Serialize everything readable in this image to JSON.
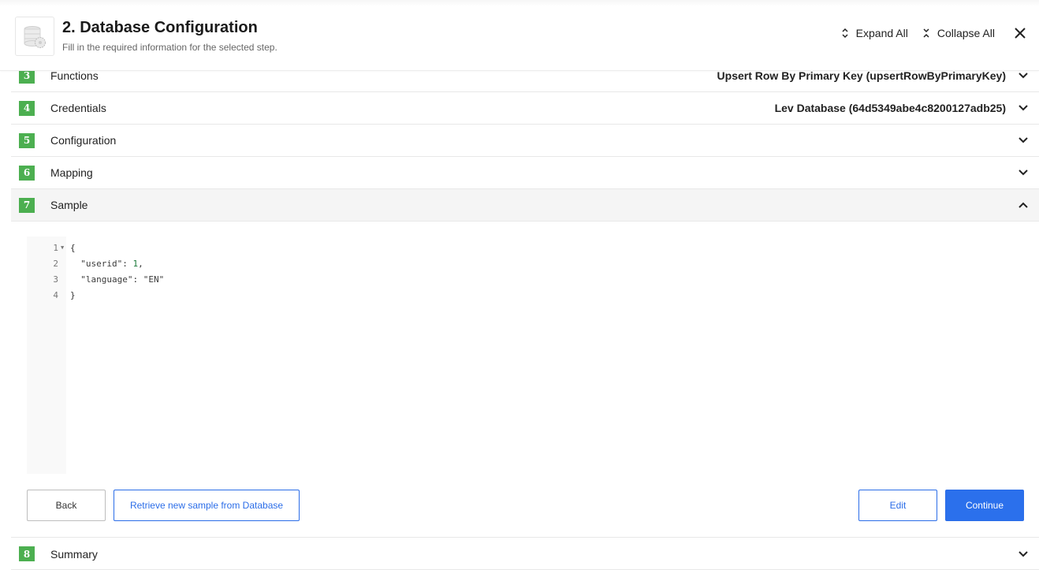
{
  "header": {
    "title": "2. Database Configuration",
    "subtitle": "Fill in the required information for the selected step.",
    "logo_icon": "database-gear-icon",
    "expand_all_label": "Expand All",
    "collapse_all_label": "Collapse All",
    "close_icon": "close-icon"
  },
  "steps": [
    {
      "number": "3",
      "label": "Functions",
      "value": "Upsert Row By Primary Key (upsertRowByPrimaryKey)",
      "expanded": false
    },
    {
      "number": "4",
      "label": "Credentials",
      "value": "Lev Database (64d5349abe4c8200127adb25)",
      "expanded": false
    },
    {
      "number": "5",
      "label": "Configuration",
      "value": "",
      "expanded": false
    },
    {
      "number": "6",
      "label": "Mapping",
      "value": "",
      "expanded": false
    },
    {
      "number": "7",
      "label": "Sample",
      "value": "",
      "expanded": true
    },
    {
      "number": "8",
      "label": "Summary",
      "value": "",
      "expanded": false
    }
  ],
  "sample": {
    "line_numbers": [
      "1",
      "2",
      "3",
      "4"
    ],
    "code_lines": {
      "l1": "{",
      "l2_key": "\"userid\"",
      "l2_sep": ": ",
      "l2_val": "1",
      "l2_end": ",",
      "l3_key": "\"language\"",
      "l3_sep": ": ",
      "l3_val": "\"EN\"",
      "l4": "}"
    },
    "buttons": {
      "back": "Back",
      "retrieve": "Retrieve new sample from Database",
      "edit": "Edit",
      "continue": "Continue"
    }
  },
  "colors": {
    "badge_green": "#4caf50",
    "primary_blue": "#2b70ec",
    "active_row_bg": "#f5f5f5"
  }
}
